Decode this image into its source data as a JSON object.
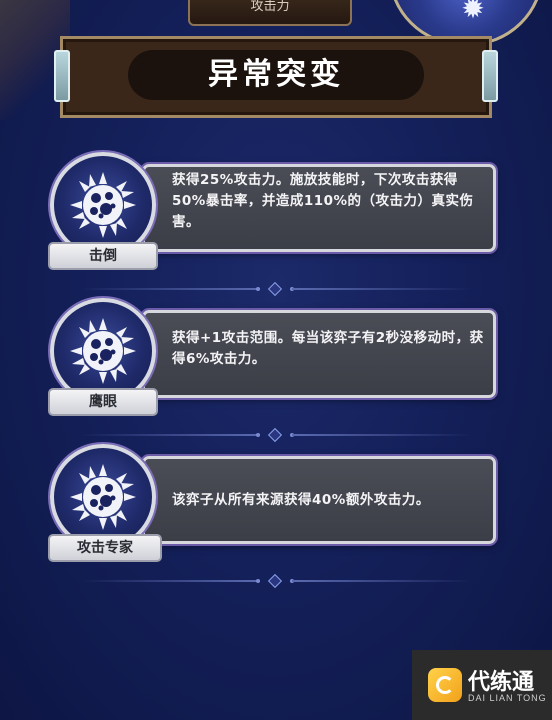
{
  "top_tab": {
    "label": "攻击力"
  },
  "header": {
    "title": "异常突变"
  },
  "augments": [
    {
      "name": "击倒",
      "description": "获得25%攻击力。施放技能时，下次攻击获得50%暴击率，并造成110%的（攻击力）真实伤害。",
      "icon": "spiked-orb-icon"
    },
    {
      "name": "鹰眼",
      "description": "获得+1攻击范围。每当该弈子有2秒没移动时，获得6%攻击力。",
      "icon": "spiked-orb-icon"
    },
    {
      "name": "攻击专家",
      "description": "该弈子从所有来源获得40%额外攻击力。",
      "icon": "spiked-orb-icon"
    }
  ],
  "watermark": {
    "title": "代练通",
    "subtitle": "DAI LIAN TONG"
  },
  "colors": {
    "background": "#14205a",
    "banner": "#3a2719",
    "panel": "#45474f",
    "plate": "#e8e9ee"
  }
}
